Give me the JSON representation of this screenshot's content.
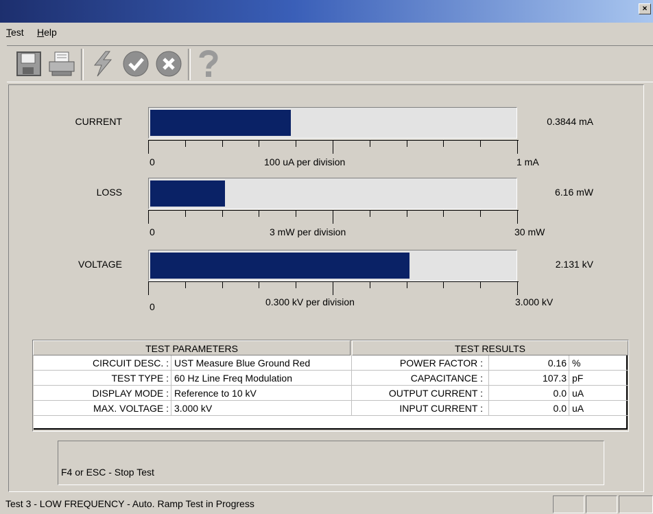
{
  "window": {
    "close_glyph": "×"
  },
  "menu": [
    {
      "label": "Test",
      "accel": "T",
      "rest": "est"
    },
    {
      "label": "Help",
      "accel": "H",
      "rest": "elp"
    }
  ],
  "toolbar": {
    "buttons": [
      "save-icon",
      "print-icon",
      "lightning-icon",
      "ok-icon",
      "cancel-icon",
      "help-icon"
    ]
  },
  "meters": [
    {
      "label": "CURRENT",
      "value": "0.3844 mA",
      "fill_fraction": 0.3844,
      "scale_min": "0",
      "scale_div": "100 uA per division",
      "scale_max": "1  mA"
    },
    {
      "label": "LOSS",
      "value": "6.16 mW",
      "fill_fraction": 0.2053,
      "scale_min": "0",
      "scale_div": "3 mW per division",
      "scale_max": "30  mW"
    },
    {
      "label": "VOLTAGE",
      "value": "2.131 kV",
      "fill_fraction": 0.7103,
      "scale_min": "0",
      "scale_div": "0.300 kV per division",
      "scale_max": "3.000 kV"
    }
  ],
  "table": {
    "params_header": "TEST PARAMETERS",
    "results_header": "TEST RESULTS",
    "params": [
      {
        "label": "CIRCUIT DESC. :",
        "value": "UST Measure Blue Ground Red"
      },
      {
        "label": "TEST TYPE :",
        "value": "60 Hz Line Freq Modulation"
      },
      {
        "label": "DISPLAY MODE :",
        "value": "Reference to 10 kV"
      },
      {
        "label": "MAX. VOLTAGE :",
        "value": " 3.000 kV"
      }
    ],
    "results": [
      {
        "label": "POWER FACTOR :",
        "value": "0.16",
        "unit": "%"
      },
      {
        "label": "CAPACITANCE :",
        "value": "107.3",
        "unit": "pF"
      },
      {
        "label": "OUTPUT CURRENT :",
        "value": "0.0",
        "unit": "uA"
      },
      {
        "label": "INPUT CURRENT :",
        "value": "0.0",
        "unit": "uA"
      }
    ]
  },
  "message": "F4 or ESC - Stop Test",
  "status": "Test 3 - LOW FREQUENCY - Auto. Ramp Test in Progress"
}
